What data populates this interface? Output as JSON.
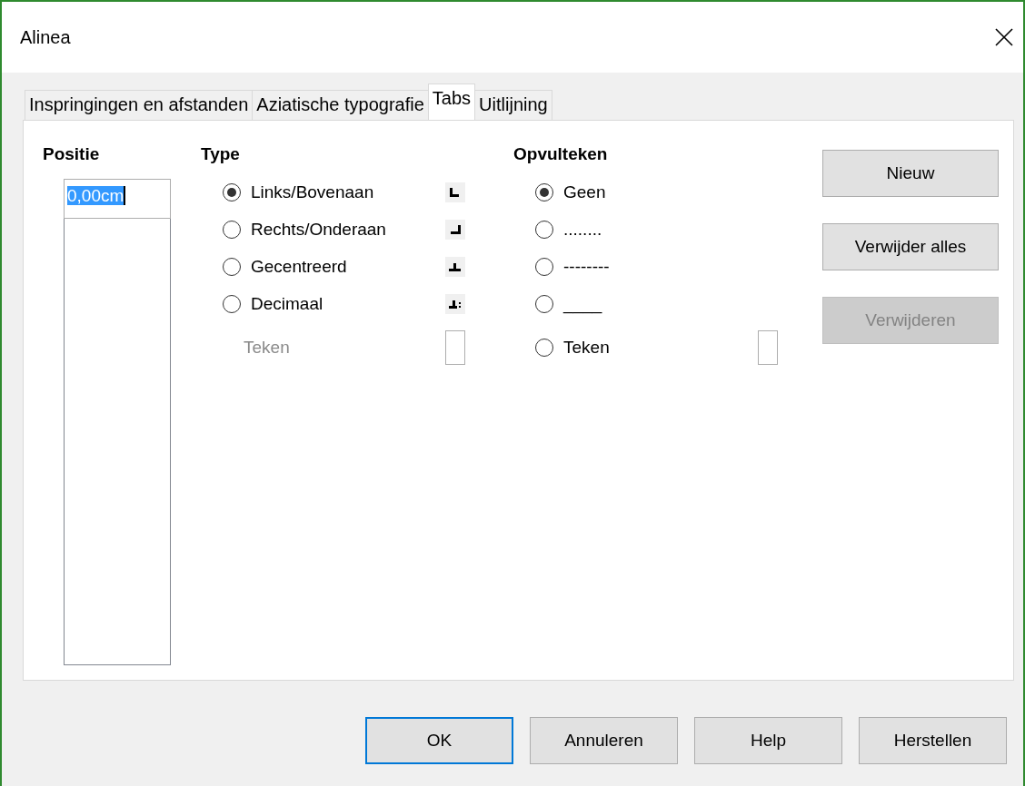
{
  "window": {
    "title": "Alinea"
  },
  "tabs": [
    {
      "label": "Inspringingen en afstanden",
      "selected": false
    },
    {
      "label": "Aziatische typografie",
      "selected": false
    },
    {
      "label": "Tabs",
      "selected": true
    },
    {
      "label": "Uitlijning",
      "selected": false
    }
  ],
  "position": {
    "label": "Positie",
    "value": "0,00cm",
    "value_selected": true
  },
  "type": {
    "label": "Type",
    "options": [
      {
        "label": "Links/Bovenaan",
        "selected": true,
        "kind": "left"
      },
      {
        "label": "Rechts/Onderaan",
        "selected": false,
        "kind": "right"
      },
      {
        "label": "Gecentreerd",
        "selected": false,
        "kind": "center"
      },
      {
        "label": "Decimaal",
        "selected": false,
        "kind": "decimal"
      }
    ],
    "character": {
      "label": "Teken",
      "disabled": true
    }
  },
  "fill": {
    "label": "Opvulteken",
    "options": [
      {
        "label": "Geen",
        "selected": true,
        "kind": "plain"
      },
      {
        "label": "........",
        "selected": false,
        "kind": "plain"
      },
      {
        "label": "--------",
        "selected": false,
        "kind": "plain"
      },
      {
        "label": "____",
        "selected": false,
        "kind": "plain"
      },
      {
        "label": "Teken",
        "selected": false,
        "kind": "character"
      }
    ]
  },
  "side_buttons": [
    {
      "label": "Nieuw",
      "disabled": false
    },
    {
      "label": "Verwijder alles",
      "disabled": false
    },
    {
      "label": "Verwijderen",
      "disabled": true
    }
  ],
  "buttons": [
    {
      "label": "OK",
      "default": true
    },
    {
      "label": "Annuleren",
      "default": false
    },
    {
      "label": "Help",
      "default": false
    },
    {
      "label": "Herstellen",
      "default": false
    }
  ]
}
